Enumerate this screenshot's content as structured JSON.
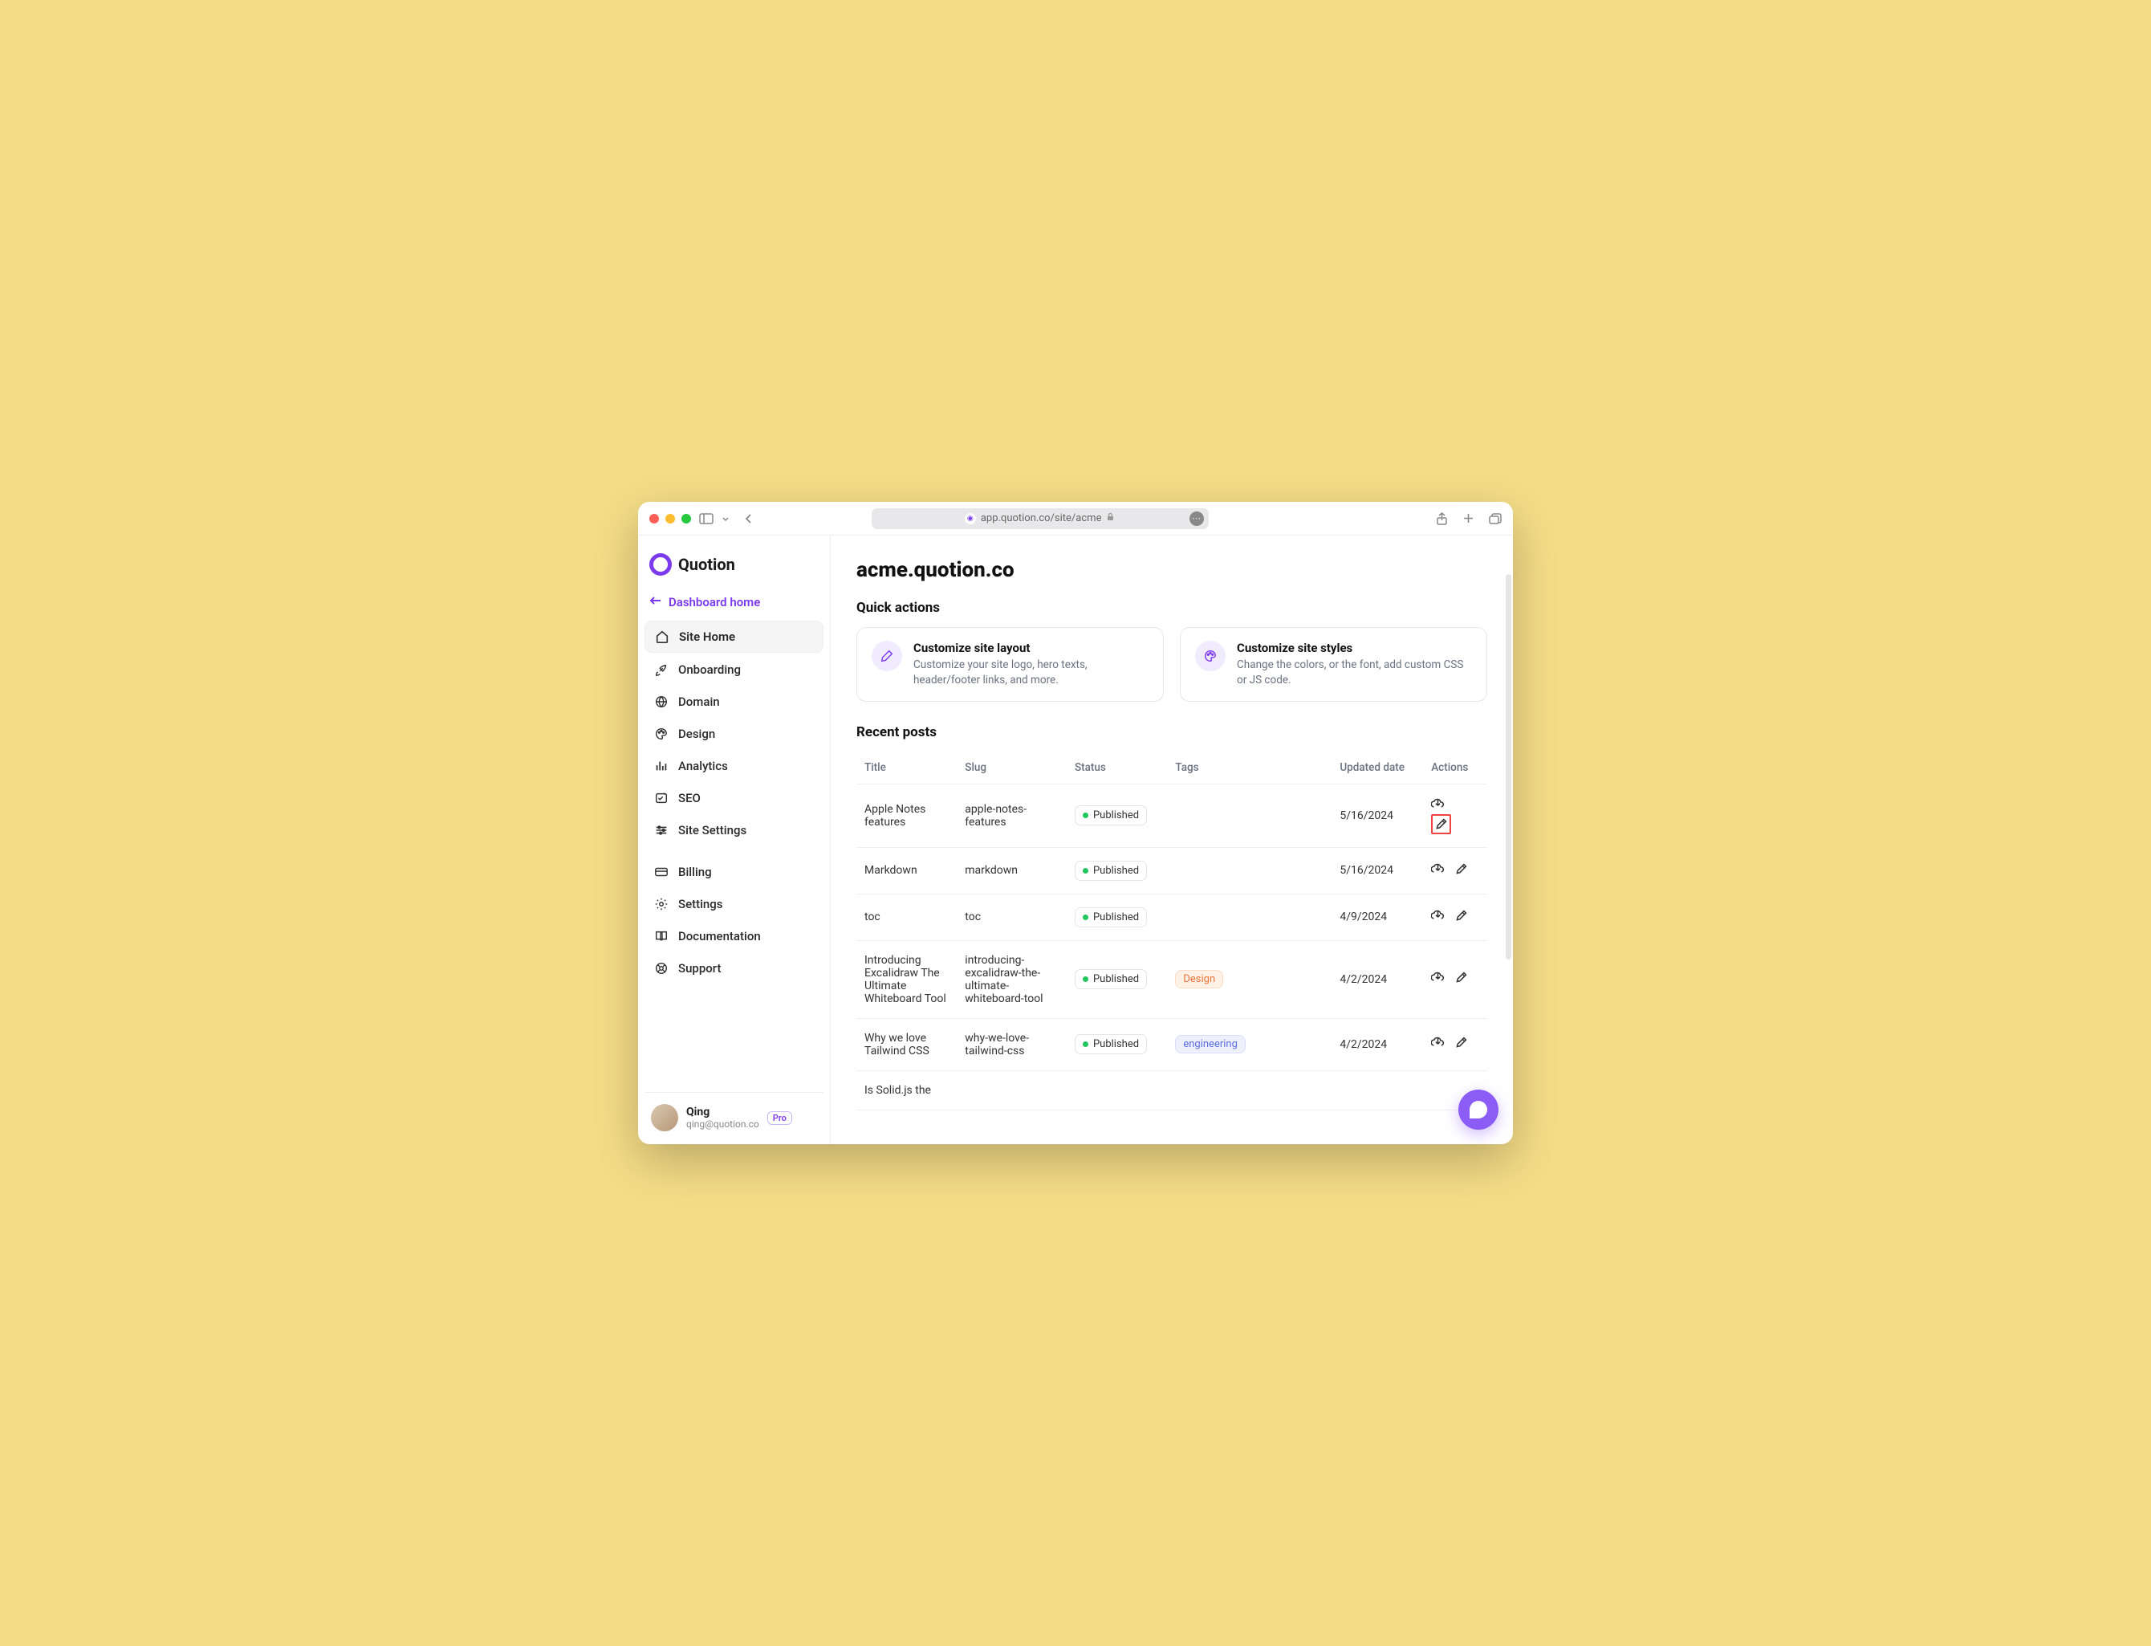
{
  "browser": {
    "url": "app.quotion.co/site/acme"
  },
  "brand": "Quotion",
  "dashboard_link": "Dashboard home",
  "colors": {
    "accent": "#7c3aed"
  },
  "nav": {
    "primary": [
      {
        "label": "Site Home",
        "icon": "home-icon",
        "active": true
      },
      {
        "label": "Onboarding",
        "icon": "rocket-icon"
      },
      {
        "label": "Domain",
        "icon": "globe-icon"
      },
      {
        "label": "Design",
        "icon": "palette-icon"
      },
      {
        "label": "Analytics",
        "icon": "chart-icon"
      },
      {
        "label": "SEO",
        "icon": "seo-icon"
      },
      {
        "label": "Site Settings",
        "icon": "sliders-icon"
      }
    ],
    "secondary": [
      {
        "label": "Billing",
        "icon": "card-icon"
      },
      {
        "label": "Settings",
        "icon": "gear-icon"
      },
      {
        "label": "Documentation",
        "icon": "book-icon"
      },
      {
        "label": "Support",
        "icon": "support-icon"
      }
    ]
  },
  "user": {
    "name": "Qing",
    "email": "qing@quotion.co",
    "plan": "Pro"
  },
  "page": {
    "title": "acme.quotion.co",
    "quick_actions_heading": "Quick actions",
    "recent_posts_heading": "Recent posts"
  },
  "quick_actions": [
    {
      "title": "Customize site layout",
      "desc": "Customize your site logo, hero texts, header/footer links, and more.",
      "icon": "pen-icon"
    },
    {
      "title": "Customize site styles",
      "desc": "Change the colors, or the font, add custom CSS or JS code.",
      "icon": "palette-icon"
    }
  ],
  "table": {
    "headers": {
      "title": "Title",
      "slug": "Slug",
      "status": "Status",
      "tags": "Tags",
      "updated": "Updated date",
      "actions": "Actions"
    },
    "rows": [
      {
        "title": "Apple Notes features",
        "slug": "apple-notes-features",
        "status": "Published",
        "tags": [],
        "updated": "5/16/2024",
        "highlight": true
      },
      {
        "title": "Markdown",
        "slug": "markdown",
        "status": "Published",
        "tags": [],
        "updated": "5/16/2024"
      },
      {
        "title": "toc",
        "slug": "toc",
        "status": "Published",
        "tags": [],
        "updated": "4/9/2024"
      },
      {
        "title": "Introducing Excalidraw The Ultimate Whiteboard Tool",
        "slug": "introducing-excalidraw-the-ultimate-whiteboard-tool",
        "status": "Published",
        "tags": [
          {
            "label": "Design",
            "class": "tag-design"
          }
        ],
        "updated": "4/2/2024"
      },
      {
        "title": "Why we love Tailwind CSS",
        "slug": "why-we-love-tailwind-css",
        "status": "Published",
        "tags": [
          {
            "label": "engineering",
            "class": "tag-engineering"
          }
        ],
        "updated": "4/2/2024"
      },
      {
        "title": "Is Solid.js the",
        "slug": "",
        "status": "",
        "tags": [],
        "updated": ""
      }
    ]
  }
}
